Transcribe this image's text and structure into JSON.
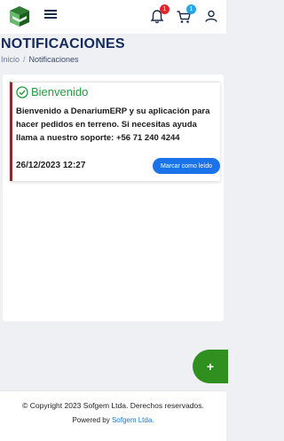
{
  "header": {
    "notifications_count": "1",
    "cart_count": "1"
  },
  "page": {
    "title": "NOTIFICACIONES",
    "breadcrumb": {
      "home": "Inicio",
      "separator": "/",
      "current": "Notificaciones"
    }
  },
  "notification": {
    "title": "Bienvenido",
    "message": "Bienvenido a DenariumERP y su aplicación para hacer pedidos en terreno. Si necesitas ayuda llama a nuestro soporte: +56 71 240 4244",
    "date": "26/12/2023 12:27",
    "action_label": "Marcar como leído"
  },
  "fab": {
    "label": "+"
  },
  "footer": {
    "copyright": "© Copyright 2023 Sofgem Ltda. Derechos reservados.",
    "powered_prefix": "Powered by",
    "powered_link": "Sofgem Ltda."
  },
  "colors": {
    "accent_blue": "#1a73e8",
    "title_navy": "#142a5c",
    "success_green": "#1f9d3b",
    "card_border_red": "#c1121f",
    "fab_green": "#2f8f1f",
    "badge_red": "#e0262d",
    "badge_blue": "#22a7e8"
  },
  "icons": [
    "app-logo-icon",
    "menu-icon",
    "bell-icon",
    "cart-icon",
    "user-icon",
    "check-circle-icon"
  ]
}
